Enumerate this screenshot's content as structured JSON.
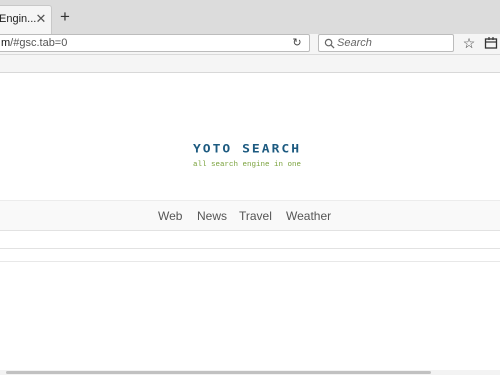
{
  "browser": {
    "tab": {
      "title": "Engin...",
      "close_glyph": "✕"
    },
    "new_tab_glyph": "+",
    "url": {
      "host": "m",
      "path": "/#gsc.tab=0"
    },
    "reload_glyph": "↻",
    "search": {
      "placeholder": "Search"
    },
    "bookmark_glyph": "☆"
  },
  "page": {
    "logo": {
      "title": "YOTO SEARCH",
      "tagline": "all search engine in one"
    },
    "nav": [
      {
        "label": "Web"
      },
      {
        "label": "News"
      },
      {
        "label": "Travel"
      },
      {
        "label": "Weather"
      }
    ]
  },
  "colors": {
    "logo_blue": "#1c5a80",
    "tagline_green": "#7aa23c"
  },
  "icons": {
    "tab_close": "close-icon",
    "new_tab": "plus-icon",
    "reload": "reload-icon",
    "search": "search-icon",
    "bookmark": "star-icon",
    "library": "library-icon"
  }
}
